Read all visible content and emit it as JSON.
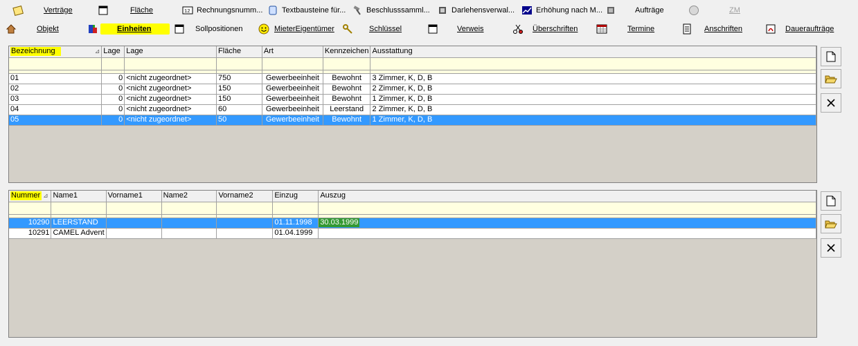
{
  "toolbar": {
    "row1": [
      {
        "name": "vertraege",
        "label": "Verträge",
        "icon": "notepad-icon"
      },
      {
        "name": "flaeche",
        "label": "Fläche",
        "icon": "window-icon"
      },
      {
        "name": "rechnungsnummern",
        "label": "Rechnungsnumm...",
        "icon": "numbers-icon"
      },
      {
        "name": "textbausteine",
        "label": "Textbausteine für...",
        "icon": "scroll-icon"
      },
      {
        "name": "beschlusssammlung",
        "label": "Beschlusssamml...",
        "icon": "hammer-icon"
      },
      {
        "name": "darlehensverwaltung",
        "label": "Darlehensverwal...",
        "icon": "coins-icon"
      },
      {
        "name": "erhoehung",
        "label": "Erhöhung nach M...",
        "icon": "chart-icon"
      },
      {
        "name": "auftraege",
        "label": "Aufträge",
        "icon": "cube-icon"
      },
      {
        "name": "zm",
        "label": "ZM",
        "icon": "circle-icon"
      }
    ],
    "row2": [
      {
        "name": "objekt",
        "label": "Objekt",
        "icon": "house-icon"
      },
      {
        "name": "einheiten",
        "label": "Einheiten",
        "icon": "blocks-icon"
      },
      {
        "name": "sollpositionen",
        "label": "Sollpositionen",
        "icon": "window-icon"
      },
      {
        "name": "mieter-eigentuemer",
        "label": "MieterEigentümer",
        "icon": "smiley-icon"
      },
      {
        "name": "schluessel",
        "label": "Schlüssel",
        "icon": "key-icon"
      },
      {
        "name": "verweis",
        "label": "Verweis",
        "icon": "window-icon"
      },
      {
        "name": "ueberschriften",
        "label": "Überschriften",
        "icon": "scissors-icon"
      },
      {
        "name": "termine",
        "label": "Termine",
        "icon": "calendar-icon"
      },
      {
        "name": "anschriften",
        "label": "Anschriften",
        "icon": "document-icon"
      },
      {
        "name": "dauerauftraege",
        "label": "Daueraufträge",
        "icon": "pdf-icon"
      }
    ]
  },
  "units_table": {
    "columns": [
      "Bezeichnung",
      "Lage",
      "Lage",
      "Fläche",
      "Art",
      "Kennzeichen",
      "Ausstattung"
    ],
    "rows": [
      [
        "01",
        "0",
        "<nicht zugeordnet>",
        "750",
        "Gewerbeeinheit",
        "Bewohnt",
        "3 Zimmer, K, D, B"
      ],
      [
        "02",
        "0",
        "<nicht zugeordnet>",
        "150",
        "Gewerbeeinheit",
        "Bewohnt",
        "2 Zimmer, K, D, B"
      ],
      [
        "03",
        "0",
        "<nicht zugeordnet>",
        "150",
        "Gewerbeeinheit",
        "Bewohnt",
        "1 Zimmer, K, D, B"
      ],
      [
        "04",
        "0",
        "<nicht zugeordnet>",
        "60",
        "Gewerbeeinheit",
        "Leerstand",
        "2 Zimmer, K, D, B"
      ],
      [
        "05",
        "0",
        "<nicht zugeordnet>",
        "50",
        "Gewerbeeinheit",
        "Bewohnt",
        "1 Zimmer, K, D, B"
      ]
    ],
    "selected_row": 4
  },
  "tenants_table": {
    "columns": [
      "Nummer",
      "Name1",
      "Vorname1",
      "Name2",
      "Vorname2",
      "Einzug",
      "Auszug"
    ],
    "rows": [
      [
        "10290",
        "LEERSTAND",
        "",
        "",
        "",
        "01.11.1998",
        "30.03.1999"
      ],
      [
        "10291",
        "CAMEL Advent",
        "",
        "",
        "",
        "01.04.1999",
        ""
      ]
    ],
    "selected_row": 0
  },
  "colors": {
    "highlight": "#ffff00",
    "selection": "#3399ff",
    "auszug_highlight": "#339933",
    "grid_background": "#d4d0c8",
    "filter_row": "#ffffe0"
  }
}
